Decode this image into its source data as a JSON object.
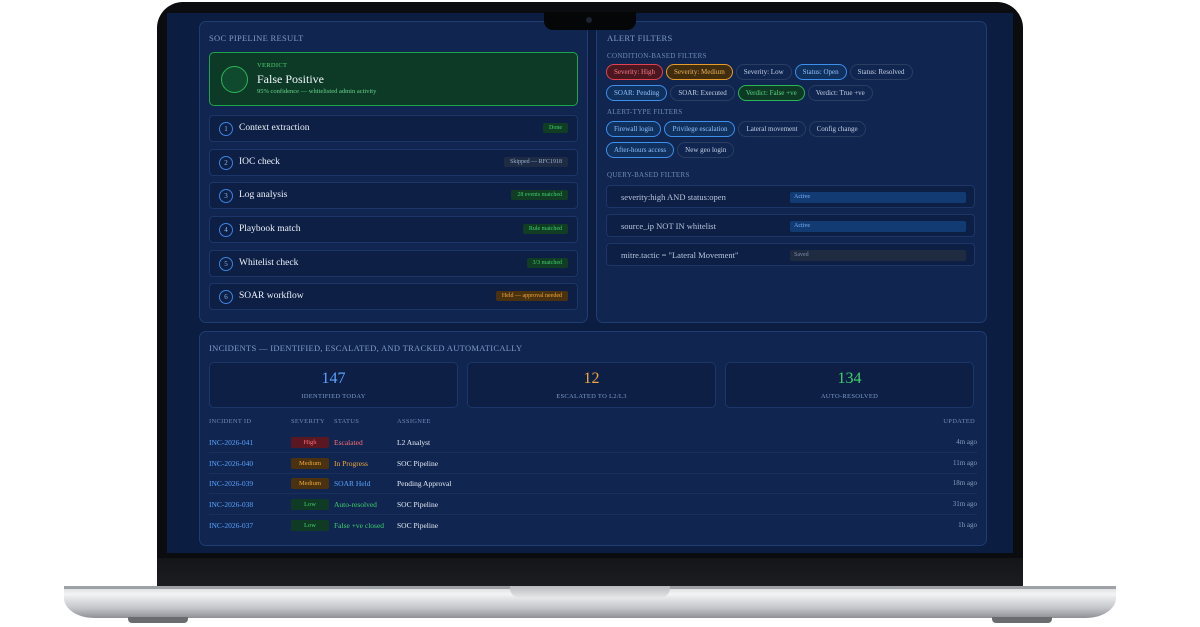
{
  "pipeline": {
    "title": "SOC PIPELINE RESULT",
    "verdict": {
      "label": "VERDICT",
      "value": "False Positive",
      "detail": "95% confidence — whitelisted admin activity"
    },
    "steps": [
      {
        "num": "1",
        "label": "Context extraction",
        "badge": "Done",
        "tone": "green"
      },
      {
        "num": "2",
        "label": "IOC check",
        "badge": "Skipped — RFC1918",
        "tone": "gray"
      },
      {
        "num": "3",
        "label": "Log analysis",
        "badge": "28 events matched",
        "tone": "green"
      },
      {
        "num": "4",
        "label": "Playbook match",
        "badge": "Rule matched",
        "tone": "green"
      },
      {
        "num": "5",
        "label": "Whitelist check",
        "badge": "3/3 matched",
        "tone": "green"
      },
      {
        "num": "6",
        "label": "SOAR workflow",
        "badge": "Held — approval needed",
        "tone": "amber"
      }
    ]
  },
  "filters": {
    "title": "ALERT FILTERS",
    "condition_title": "CONDITION-BASED FILTERS",
    "condition_row1": [
      {
        "label": "Severity: High",
        "tone": "red"
      },
      {
        "label": "Severity: Medium",
        "tone": "amber"
      },
      {
        "label": "Severity: Low",
        "tone": "plain"
      },
      {
        "label": "Status: Open",
        "tone": "blue"
      },
      {
        "label": "Status: Resolved",
        "tone": "plain"
      }
    ],
    "condition_row2": [
      {
        "label": "SOAR: Pending",
        "tone": "blue"
      },
      {
        "label": "SOAR: Executed",
        "tone": "plain"
      },
      {
        "label": "Verdict: False +ve",
        "tone": "green"
      },
      {
        "label": "Verdict: True +ve",
        "tone": "plain"
      }
    ],
    "type_title": "ALERT-TYPE FILTERS",
    "type_row1": [
      {
        "label": "Firewall login",
        "tone": "blue"
      },
      {
        "label": "Privilege escalation",
        "tone": "blue"
      },
      {
        "label": "Lateral movement",
        "tone": "plain"
      },
      {
        "label": "Config change",
        "tone": "plain"
      }
    ],
    "type_row2": [
      {
        "label": "After-hours access",
        "tone": "blue"
      },
      {
        "label": "New geo login",
        "tone": "plain"
      }
    ],
    "query_title": "QUERY-BASED FILTERS",
    "queries": [
      {
        "text": "severity:high AND status:open",
        "state": "Active"
      },
      {
        "text": "source_ip NOT IN whitelist",
        "state": "Active"
      },
      {
        "text": "mitre.tactic = \"Lateral Movement\"",
        "state": "Saved"
      }
    ]
  },
  "incidents": {
    "title": "INCIDENTS — IDENTIFIED, ESCALATED, AND TRACKED AUTOMATICALLY",
    "stats": [
      {
        "value": "147",
        "label": "IDENTIFIED TODAY",
        "color": "#5aa3ff"
      },
      {
        "value": "12",
        "label": "ESCALATED TO L2/L3",
        "color": "#f0a83a"
      },
      {
        "value": "134",
        "label": "AUTO-RESOLVED",
        "color": "#3fd16b"
      }
    ],
    "columns": {
      "id": "INCIDENT ID",
      "severity": "SEVERITY",
      "status": "STATUS",
      "assignee": "ASSIGNEE",
      "updated": "UPDATED"
    },
    "rows": [
      {
        "id": "INC-2026-041",
        "severity": "High",
        "sev_tone": "high",
        "status": "Escalated",
        "status_color": "#ff6b76",
        "assignee": "L2 Analyst",
        "updated": "4m ago"
      },
      {
        "id": "INC-2026-040",
        "severity": "Medium",
        "sev_tone": "med",
        "status": "In Progress",
        "status_color": "#f0a83a",
        "assignee": "SOC Pipeline",
        "updated": "11m ago"
      },
      {
        "id": "INC-2026-039",
        "severity": "Medium",
        "sev_tone": "med",
        "status": "SOAR Held",
        "status_color": "#5aa3ff",
        "assignee": "Pending Approval",
        "updated": "18m ago"
      },
      {
        "id": "INC-2026-038",
        "severity": "Low",
        "sev_tone": "low",
        "status": "Auto-resolved",
        "status_color": "#3fd16b",
        "assignee": "SOC Pipeline",
        "updated": "31m ago"
      },
      {
        "id": "INC-2026-037",
        "severity": "Low",
        "sev_tone": "low",
        "status": "False +ve closed",
        "status_color": "#3fd16b",
        "assignee": "SOC Pipeline",
        "updated": "1h ago"
      }
    ]
  }
}
